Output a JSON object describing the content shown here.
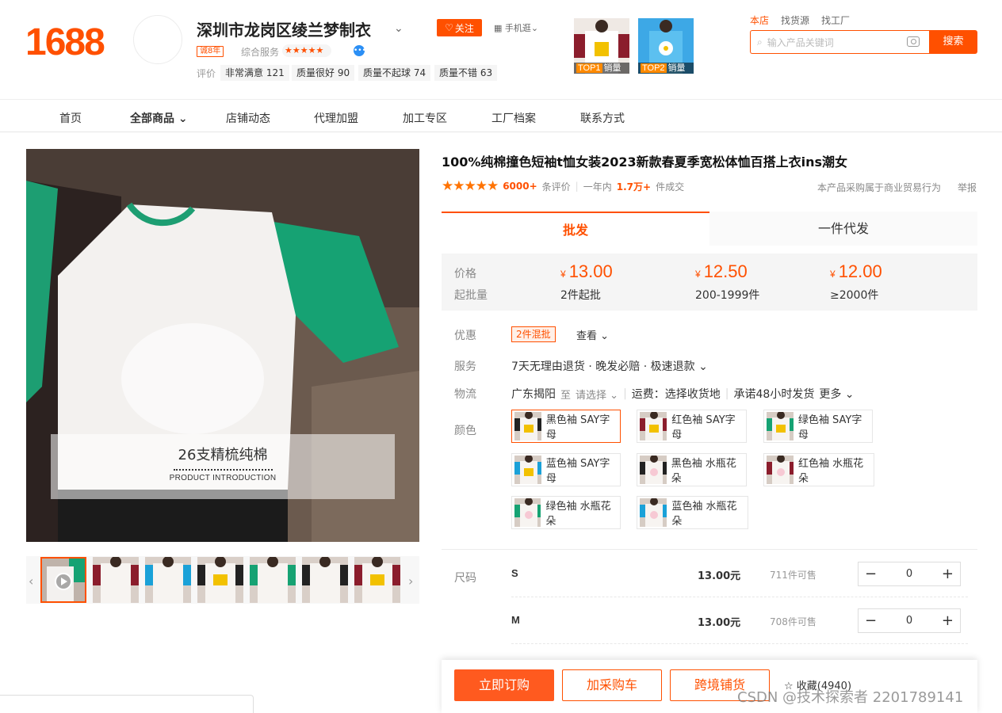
{
  "logo": "1688",
  "shop": {
    "name": "深圳市龙岗区绫兰梦制衣",
    "follow_label": "关注",
    "mobile_label": "手机逛",
    "years_badge": "诚8年",
    "service_label": "综合服务",
    "service_rating": 4.5,
    "reviews_label": "评价",
    "review_tags": [
      "非常满意 121",
      "质量很好 90",
      "质量不起球 74",
      "质量不错 63"
    ],
    "top_sellers": [
      {
        "rank": "TOP1",
        "label": "销量"
      },
      {
        "rank": "TOP2",
        "label": "销量"
      }
    ]
  },
  "search": {
    "tabs": [
      "本店",
      "找货源",
      "找工厂"
    ],
    "placeholder": "输入产品关键词",
    "button_label": "搜索"
  },
  "nav": {
    "items": [
      "首页",
      "全部商品",
      "店铺动态",
      "代理加盟",
      "加工专区",
      "工厂档案",
      "联系方式"
    ]
  },
  "gallery": {
    "intro_title": "26支精梳纯棉",
    "intro_sub": "PRODUCT INTRODUCTION",
    "thumb_count": 7
  },
  "product": {
    "title": "100%纯棉撞色短袖t恤女装2023新款春夏季宽松体恤百搭上衣ins潮女",
    "rating_stars": 5,
    "review_count": "6000+",
    "review_label": "条评价",
    "yearly_label": "一年内",
    "sold": "1.7万+",
    "sold_label": "件成交",
    "business_notice": "本产品采购属于商业贸易行为",
    "report_label": "举报",
    "fulfil_tabs": [
      "批发",
      "一件代发"
    ],
    "price_label": "价格",
    "moq_label": "起批量",
    "currency": "¥",
    "tiers": [
      {
        "price": "13.00",
        "qty": "2件起批"
      },
      {
        "price": "12.50",
        "qty": "200-1999件"
      },
      {
        "price": "12.00",
        "qty": "≥2000件"
      }
    ],
    "discount_label": "优惠",
    "promo_tag": "2件混批",
    "view_label": "查看",
    "service_label": "服务",
    "services": "7天无理由退货 · 晚发必赔 · 极速退款",
    "logistics_label": "物流",
    "origin": "广东揭阳",
    "to": "至",
    "choose": "请选择",
    "freight": "运费：选择收货地",
    "promise": "承诺48小时发货",
    "more": "更多",
    "color_label": "颜色",
    "colors": [
      "黑色袖 SAY字母",
      "红色袖 SAY字母",
      "绿色袖 SAY字母",
      "蓝色袖 SAY字母",
      "黑色袖 水瓶花朵",
      "红色袖 水瓶花朵",
      "绿色袖 水瓶花朵",
      "蓝色袖 水瓶花朵"
    ],
    "size_label": "尺码",
    "sizes": [
      {
        "size": "S",
        "price": "13.00元",
        "stock": "711件可售",
        "qty": "0"
      },
      {
        "size": "M",
        "price": "13.00元",
        "stock": "708件可售",
        "qty": "0"
      }
    ]
  },
  "actions": {
    "buy": "立即订购",
    "cart": "加采购车",
    "cross": "跨境铺货",
    "favorite": "收藏(4940)"
  },
  "watermark": "CSDN @技术探索者 2201789141",
  "colors_theme": {
    "accent": "#ff5000",
    "green": "#12a07a",
    "blue": "#1aa1d8"
  }
}
